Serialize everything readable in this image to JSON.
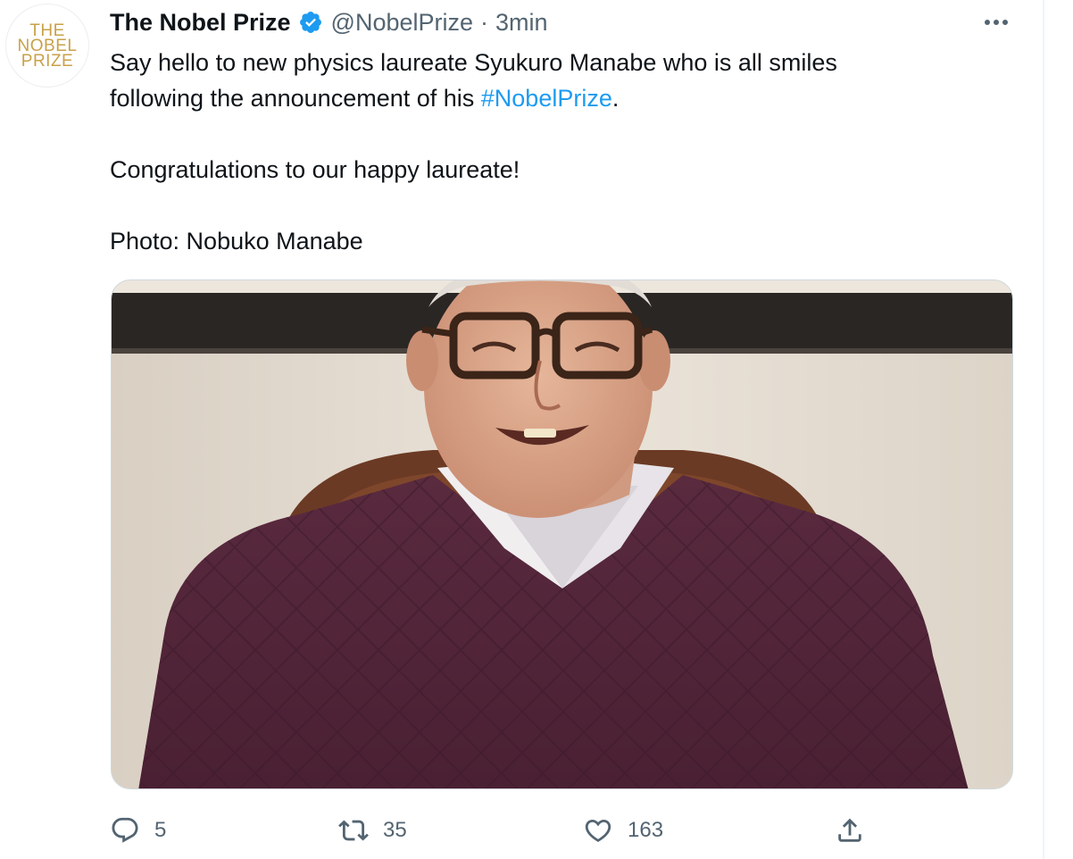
{
  "tweet": {
    "author": {
      "name": "The Nobel Prize",
      "handle": "@NobelPrize",
      "avatar_lines": [
        "THE",
        "NOBEL",
        "PRIZE"
      ],
      "verified": true
    },
    "separator": "·",
    "time": "3min",
    "text": {
      "line1": "Say hello to new physics laureate Syukuro Manabe who is all smiles",
      "line2_before": "following the announcement of his ",
      "hashtag": "#NobelPrize",
      "line2_after": ".",
      "para2": "Congratulations to our happy laureate!",
      "para3": "Photo: Nobuko Manabe"
    },
    "actions": {
      "reply_count": "5",
      "retweet_count": "35",
      "like_count": "163"
    }
  },
  "colors": {
    "accent": "#1d9bf0",
    "secondary_text": "#536471",
    "avatar_gold": "#c9a14a"
  },
  "icons": [
    "verified-badge-icon",
    "more-options-icon",
    "reply-icon",
    "retweet-icon",
    "like-icon",
    "share-icon"
  ]
}
